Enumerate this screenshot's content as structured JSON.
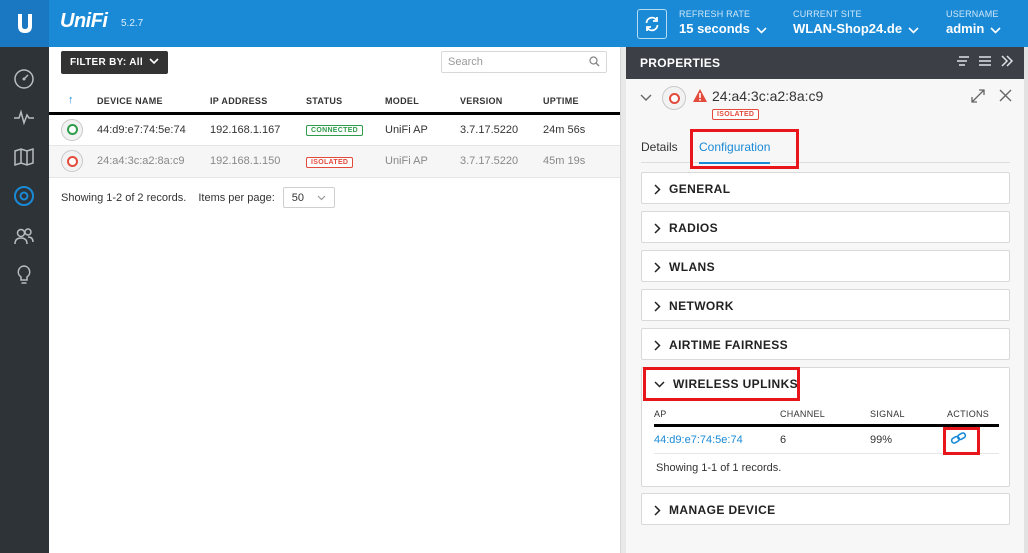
{
  "header": {
    "brand": "UniFi",
    "version": "5.2.7",
    "refresh": {
      "caption": "REFRESH RATE",
      "value": "15 seconds"
    },
    "site": {
      "caption": "CURRENT SITE",
      "value": "WLAN-Shop24.de"
    },
    "user": {
      "caption": "USERNAME",
      "value": "admin"
    }
  },
  "sidebar": {
    "items": [
      {
        "name": "dashboard-icon"
      },
      {
        "name": "statistics-icon"
      },
      {
        "name": "map-icon"
      },
      {
        "name": "devices-icon",
        "active": true
      },
      {
        "name": "clients-icon"
      },
      {
        "name": "insights-icon"
      }
    ]
  },
  "devices": {
    "filter_label": "FILTER BY: All",
    "search_placeholder": "Search",
    "columns": [
      "↑",
      "DEVICE NAME",
      "IP ADDRESS",
      "STATUS",
      "MODEL",
      "VERSION",
      "UPTIME"
    ],
    "rows": [
      {
        "name": "44:d9:e7:74:5e:74",
        "ip": "192.168.1.167",
        "status": "CONNECTED",
        "model": "UniFi AP",
        "version": "3.7.17.5220",
        "uptime": "24m 56s"
      },
      {
        "name": "24:a4:3c:a2:8a:c9",
        "ip": "192.168.1.150",
        "status": "ISOLATED",
        "model": "UniFi AP",
        "version": "3.7.17.5220",
        "uptime": "45m 19s"
      }
    ],
    "showing": "Showing 1-2 of 2 records.",
    "per_page_label": "Items per page:",
    "per_page_value": "50"
  },
  "properties": {
    "title": "PROPERTIES",
    "device_name": "24:a4:3c:a2:8a:c9",
    "device_status": "ISOLATED",
    "tabs": {
      "details": "Details",
      "configuration": "Configuration"
    },
    "sections": {
      "general": "GENERAL",
      "radios": "RADIOS",
      "wlans": "WLANS",
      "network": "NETWORK",
      "airtime": "AIRTIME FAIRNESS",
      "uplinks": "WIRELESS UPLINKS",
      "manage": "MANAGE DEVICE"
    },
    "uplinks": {
      "columns": [
        "AP",
        "CHANNEL",
        "SIGNAL",
        "ACTIONS"
      ],
      "rows": [
        {
          "ap": "44:d9:e7:74:5e:74",
          "channel": "6",
          "signal": "99%"
        }
      ],
      "showing": "Showing 1-1 of 1 records."
    }
  },
  "colors": {
    "header_blue": "#1a8ad6",
    "sidebar_dark": "#2e3338",
    "connected_green": "#2e9c4a",
    "isolated_red": "#e24a3b",
    "highlight_red": "#e8161b"
  }
}
